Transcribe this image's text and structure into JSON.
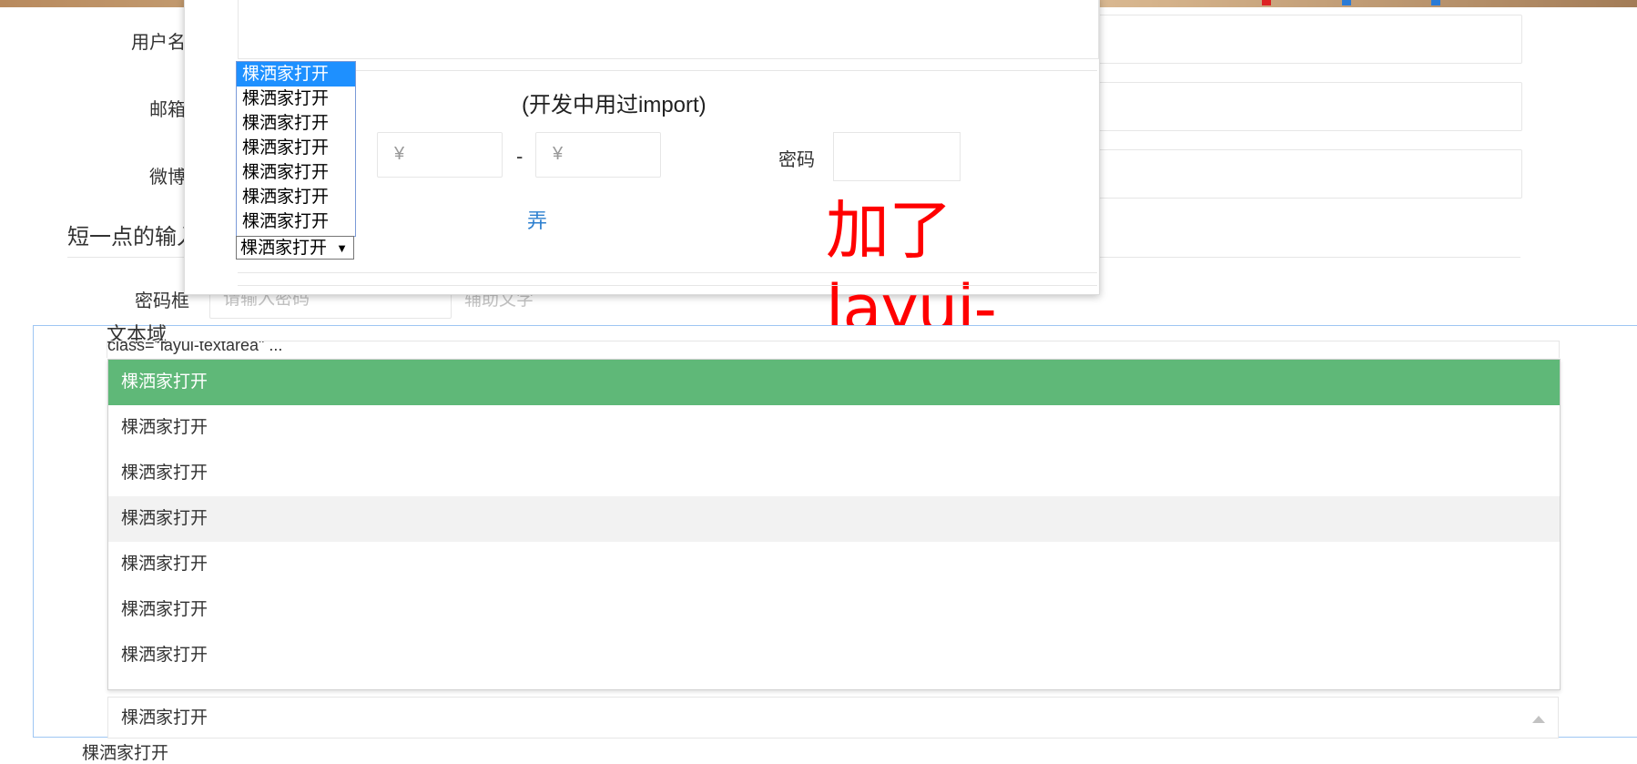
{
  "form": {
    "username_label": "用户名",
    "email_label": "邮箱",
    "weibo_label": "微博",
    "short_section_title": "短一点的输入",
    "password_label": "密码框",
    "password_placeholder": "请输入密码",
    "helper_text": "辅助文字",
    "textarea_label": "文本域",
    "textarea_partial_text": "class=\"layui-textarea\" ...",
    "below_select_text": "棵洒家打开"
  },
  "modal": {
    "rich_label": "(开发中用过import)",
    "currency_symbol_1": "¥",
    "range_dash": "-",
    "currency_symbol_2": "¥",
    "password_label": "密码",
    "annotation": "加了layui-ignore",
    "cut_mark": "弄"
  },
  "native_select": {
    "options": [
      "棵洒家打开",
      "棵洒家打开",
      "棵洒家打开",
      "棵洒家打开",
      "棵洒家打开",
      "棵洒家打开",
      "棵洒家打开"
    ],
    "selected": "棵洒家打开",
    "arrow": "▼"
  },
  "layui_select": {
    "options": [
      "棵洒家打开",
      "棵洒家打开",
      "棵洒家打开",
      "棵洒家打开",
      "棵洒家打开",
      "棵洒家打开",
      "棵洒家打开"
    ],
    "selected_value": "棵洒家打开"
  },
  "colors": {
    "active_option": "#5fb878",
    "hover_option": "#f2f2f2",
    "annotation": "#ff0000",
    "native_selected": "#1e90ff"
  }
}
